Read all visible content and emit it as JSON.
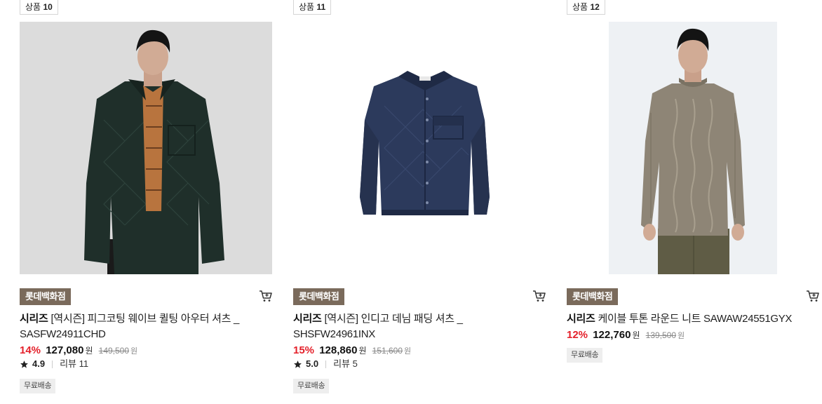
{
  "products": [
    {
      "rank_prefix": "상품",
      "rank_num": "10",
      "brand": "롯데백화점",
      "series": "시리즈",
      "name": "[역시즌] 피그코팅 웨이브 퀼팅 아우터 셔츠 _ SASFW24911CHD",
      "discount": "14%",
      "price": "127,080",
      "currency": "원",
      "original_price": "149,500",
      "rating": "4.9",
      "review_label": "리뷰 11",
      "shipping": "무료배송",
      "image_icon": "quilted-shirt-model-photo"
    },
    {
      "rank_prefix": "상품",
      "rank_num": "11",
      "brand": "롯데백화점",
      "series": "시리즈",
      "name": "[역시즌] 인디고 데님 패딩 셔츠 _ SHSFW24961INX",
      "discount": "15%",
      "price": "128,860",
      "currency": "원",
      "original_price": "151,600",
      "rating": "5.0",
      "review_label": "리뷰 5",
      "shipping": "무료배송",
      "image_icon": "denim-padded-shirt-photo"
    },
    {
      "rank_prefix": "상품",
      "rank_num": "12",
      "brand": "롯데백화점",
      "series": "시리즈",
      "name": "케이블 투톤 라운드 니트 SAWAW24551GYX",
      "discount": "12%",
      "price": "122,760",
      "currency": "원",
      "original_price": "139,500",
      "shipping": "무료배송",
      "image_icon": "cable-knit-model-photo"
    }
  ],
  "colors": {
    "brand_tag_bg": "#7a6a5b",
    "discount": "#e4202a",
    "muted": "#888888"
  },
  "icons": [
    "cart-icon",
    "star-icon"
  ]
}
